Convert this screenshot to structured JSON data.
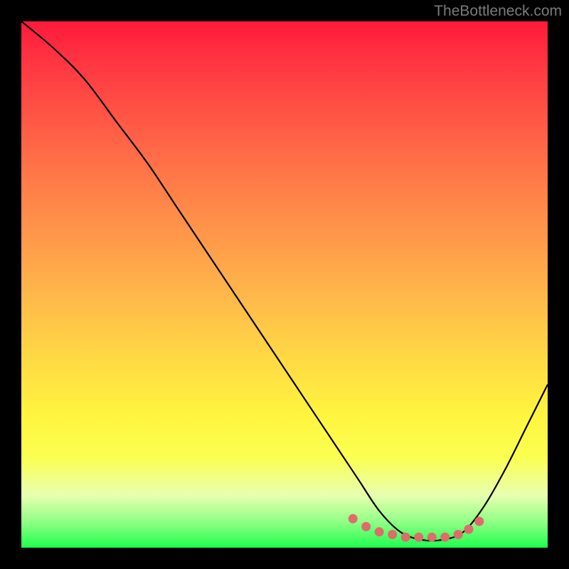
{
  "watermark": "TheBottleneck.com",
  "chart_data": {
    "type": "line",
    "title": "",
    "xlabel": "",
    "ylabel": "",
    "xlim": [
      0,
      100
    ],
    "ylim": [
      0,
      100
    ],
    "annotations": [],
    "series": [
      {
        "name": "curve",
        "x": [
          0,
          6,
          12,
          18,
          24,
          30,
          36,
          42,
          48,
          54,
          60,
          64,
          68,
          72,
          76,
          80,
          84,
          88,
          92,
          96,
          100
        ],
        "values": [
          100,
          95,
          89,
          81,
          73,
          64,
          55,
          46,
          37,
          28,
          19,
          13,
          7,
          3,
          1.5,
          1.5,
          3,
          8,
          15,
          23,
          31
        ]
      }
    ],
    "markers": {
      "x": [
        63,
        65.5,
        68,
        70.5,
        73,
        75.5,
        78,
        80.5,
        83,
        85,
        87
      ],
      "values": [
        5.5,
        4.0,
        3.0,
        2.5,
        2.0,
        2.0,
        2.0,
        2.0,
        2.5,
        3.5,
        5.0
      ]
    },
    "background_gradient": {
      "top": "#ff1a3a",
      "upper_mid": "#ff9b4a",
      "mid": "#fff53f",
      "lower_mid": "#e8ffb0",
      "bottom": "#1eff4e"
    }
  }
}
